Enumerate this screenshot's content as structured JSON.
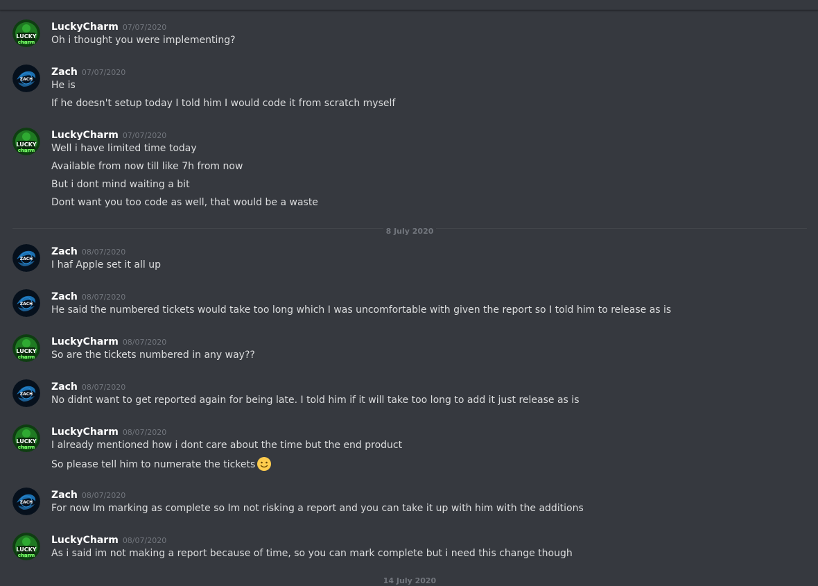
{
  "colors": {
    "background": "#36393f",
    "author": "#ffffff",
    "text": "#dcddde",
    "timestamp": "#72767d",
    "divider": "#42454a"
  },
  "messages": [
    {
      "author": "LuckyCharm",
      "timestamp": "07/07/2020",
      "avatar": "luckycharm-avatar-icon",
      "lines": [
        "Oh i thought you were implementing?"
      ]
    },
    {
      "author": "Zach",
      "timestamp": "07/07/2020",
      "avatar": "zach-avatar-icon",
      "lines": [
        "He is",
        "If he doesn't setup today I told him I would code it from scratch myself"
      ]
    },
    {
      "author": "LuckyCharm",
      "timestamp": "07/07/2020",
      "avatar": "luckycharm-avatar-icon",
      "lines": [
        "Well i have limited time today",
        "Available from now till like 7h from now",
        "But i dont mind waiting a bit",
        "Dont want you too code as well, that would be a waste"
      ]
    },
    {
      "author": "Zach",
      "timestamp": "08/07/2020",
      "avatar": "zach-avatar-icon",
      "lines": [
        "I haf Apple set it all up"
      ]
    },
    {
      "author": "Zach",
      "timestamp": "08/07/2020",
      "avatar": "zach-avatar-icon",
      "lines": [
        "He said the numbered tickets would take too long which I was uncomfortable with given the report so I told him to release as is"
      ]
    },
    {
      "author": "LuckyCharm",
      "timestamp": "08/07/2020",
      "avatar": "luckycharm-avatar-icon",
      "lines": [
        "So are the tickets numbered in any way??"
      ]
    },
    {
      "author": "Zach",
      "timestamp": "08/07/2020",
      "avatar": "zach-avatar-icon",
      "lines": [
        "No didnt want to get reported again for being late. I told him if it will take too long to add it just release as is"
      ]
    },
    {
      "author": "LuckyCharm",
      "timestamp": "08/07/2020",
      "avatar": "luckycharm-avatar-icon",
      "lines": [
        "I already mentioned how i dont care about the time but the end product",
        "So please tell him to numerate the tickets"
      ],
      "emoji": "slightly-smiling-face-icon"
    },
    {
      "author": "Zach",
      "timestamp": "08/07/2020",
      "avatar": "zach-avatar-icon",
      "lines": [
        "For now Im marking as complete so Im not risking a report and you can take it up with him with the additions"
      ]
    },
    {
      "author": "LuckyCharm",
      "timestamp": "08/07/2020",
      "avatar": "luckycharm-avatar-icon",
      "lines": [
        "As i said im not making a report because of time, so you can mark complete but i need this change though"
      ]
    }
  ],
  "date_divider": "8 July 2020",
  "bottom_divider": "14 July 2020"
}
